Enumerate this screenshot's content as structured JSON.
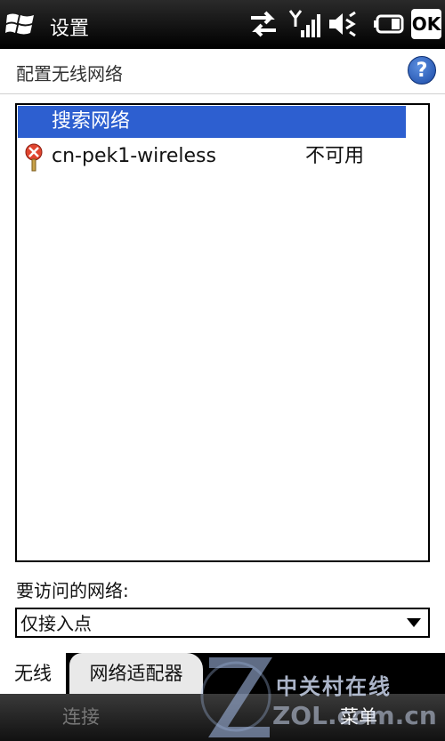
{
  "status_bar": {
    "app_title": "设置",
    "ok_label": "OK",
    "icons": [
      "windows-logo",
      "data-sync-arrows",
      "signal-bars",
      "speaker-muted",
      "battery"
    ]
  },
  "header": {
    "title": "配置无线网络",
    "help_label": "?"
  },
  "network_list": {
    "items": [
      {
        "label": "搜索网络",
        "selected": true
      },
      {
        "label": "cn-pek1-wireless",
        "status": "不可用",
        "icon": "wireless-unavailable-icon"
      }
    ]
  },
  "access": {
    "label": "要访问的网络:",
    "selected_option": "仅接入点"
  },
  "tabs": [
    {
      "label": "无线",
      "active": true
    },
    {
      "label": "网络适配器",
      "active": false
    }
  ],
  "softkeys": {
    "left": "连接",
    "right": "菜单"
  },
  "watermark": {
    "brand_cn": "中关村在线",
    "brand_en": "ZOL.com.cn"
  },
  "colors": {
    "selection": "#2d5fd0",
    "status_bar": "#000000",
    "help_button": "#1b4aa6"
  }
}
